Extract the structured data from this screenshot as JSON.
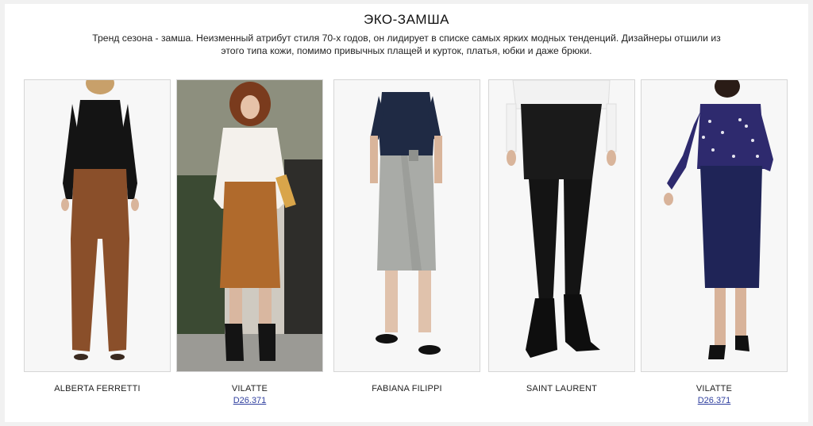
{
  "header": {
    "title": "ЭКО-ЗАМША",
    "intro": "Тренд сезона - замша. Неизменный атрибут стиля 70-х годов, он лидирует в списке самых ярких модных тенденций.  Дизайнеры отшили из этого типа кожи, помимо привычных плащей и курток, платья, юбки и даже брюки."
  },
  "products": [
    {
      "brand": "ALBERTA FERRETTI",
      "sku": "",
      "top_color": "#141414",
      "bottom_color": "#8a4f2a",
      "bottom_type": "flared-trousers"
    },
    {
      "brand": "VILATTE",
      "sku": "D26.371",
      "top_color": "#f4f1ec",
      "bottom_color": "#b06a2c",
      "bottom_type": "midi-skirt"
    },
    {
      "brand": "FABIANA FILIPPI",
      "sku": "",
      "top_color": "#1f2a44",
      "bottom_color": "#a9aba7",
      "bottom_type": "wrap-skirt"
    },
    {
      "brand": "SAINT LAURENT",
      "sku": "",
      "top_color": "#f2f2f2",
      "bottom_color": "#1a1a1a",
      "bottom_type": "mini-skirt"
    },
    {
      "brand": "VILATTE",
      "sku": "D26.371",
      "top_color": "#2e2a6e",
      "bottom_color": "#1f2457",
      "bottom_type": "pencil-skirt"
    }
  ]
}
